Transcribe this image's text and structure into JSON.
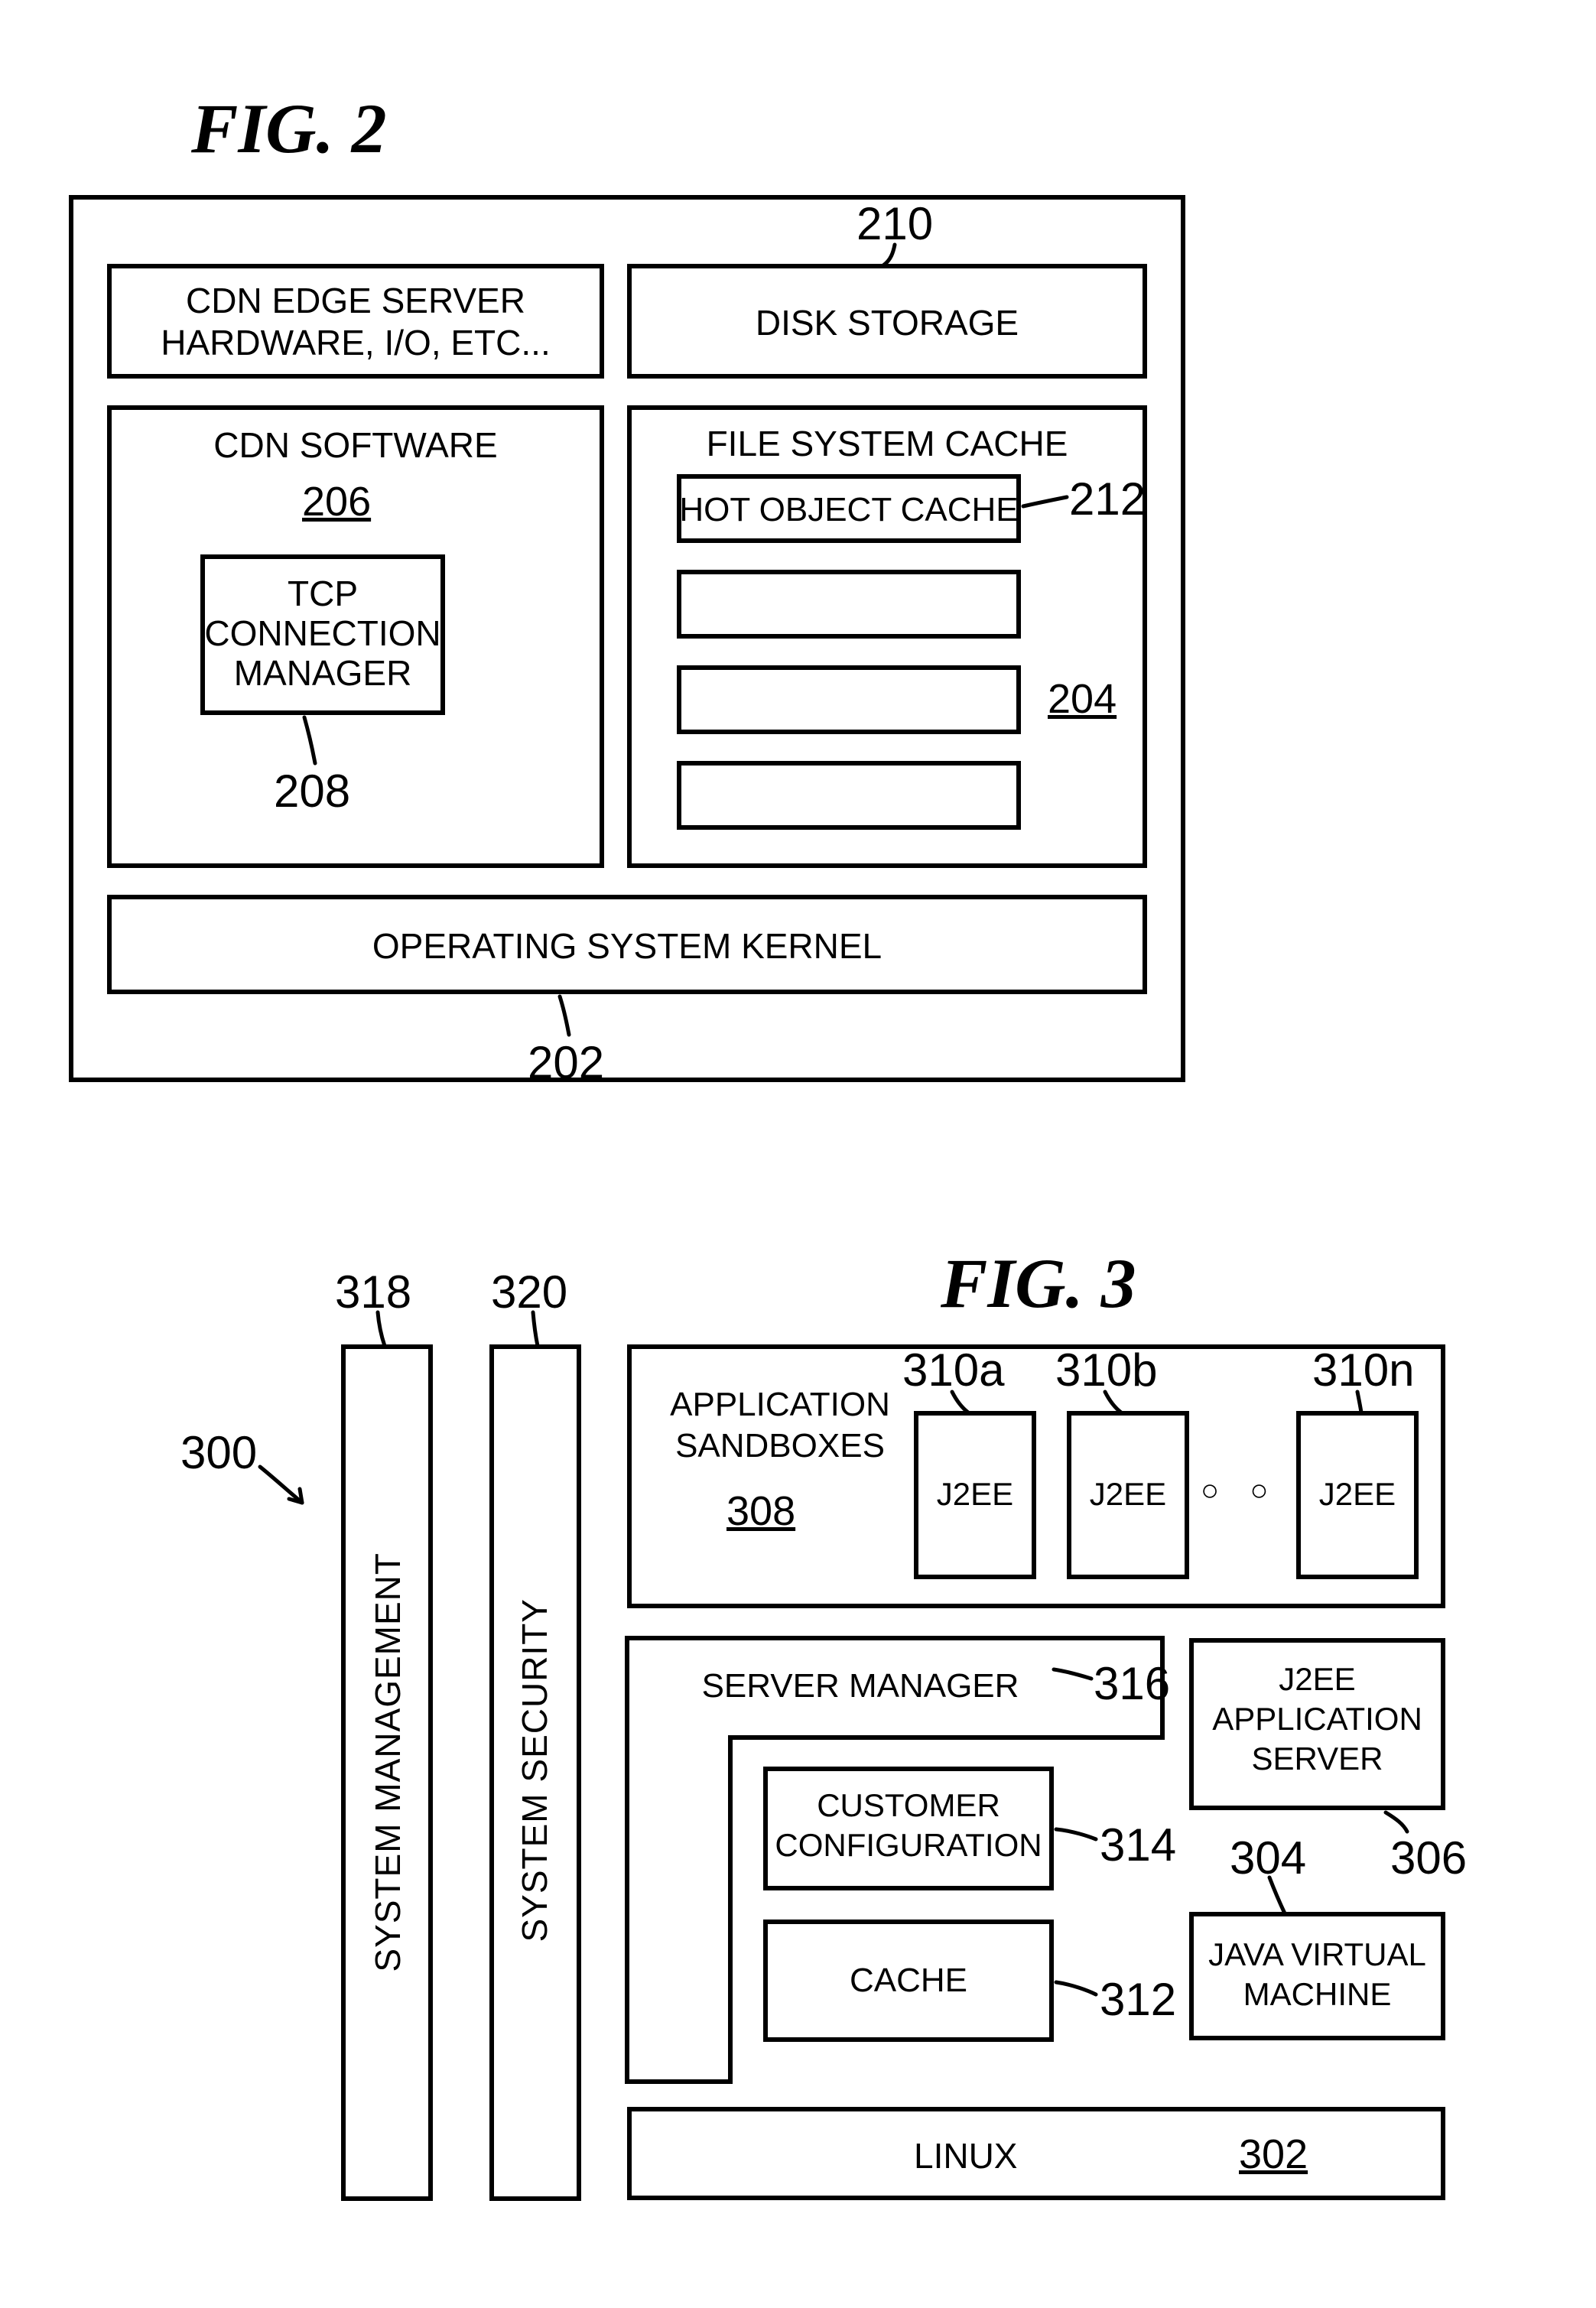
{
  "fig2": {
    "title": "FIG. 2",
    "outer": {},
    "cdnHW": "CDN EDGE SERVER\nHARDWARE, I/O, ETC...",
    "disk": "DISK STORAGE",
    "diskRef": "210",
    "cdnSW": {
      "title": "CDN SOFTWARE",
      "ref": "206",
      "tcp": "TCP\nCONNECTION\nMANAGER",
      "tcpRef": "208"
    },
    "fsCache": {
      "title": "FILE SYSTEM CACHE",
      "hot": "HOT OBJECT CACHE",
      "hotRef": "212",
      "ref": "204"
    },
    "kernel": "OPERATING SYSTEM KERNEL",
    "kernelRef": "202"
  },
  "fig3": {
    "title": "FIG. 3",
    "ref300": "300",
    "sysMgmt": "SYSTEM MANAGEMENT",
    "sysMgmtRef": "318",
    "sysSec": "SYSTEM SECURITY",
    "sysSecRef": "320",
    "sandboxes": {
      "title": "APPLICATION\nSANDBOXES",
      "ref": "308",
      "j2ee": "J2EE",
      "refA": "310a",
      "refB": "310b",
      "refN": "310n",
      "dots": "○  ○  ○"
    },
    "serverMgr": "SERVER MANAGER",
    "serverMgrRef": "316",
    "custCfg": "CUSTOMER\nCONFIGURATION",
    "custCfgRef": "314",
    "cache": "CACHE",
    "cacheRef": "312",
    "j2eeApp": "J2EE\nAPPLICATION\nSERVER",
    "j2eeAppRef": "306",
    "jvm": "JAVA VIRTUAL\nMACHINE",
    "jvmRef": "304",
    "linux": "LINUX",
    "linuxRef": "302"
  }
}
